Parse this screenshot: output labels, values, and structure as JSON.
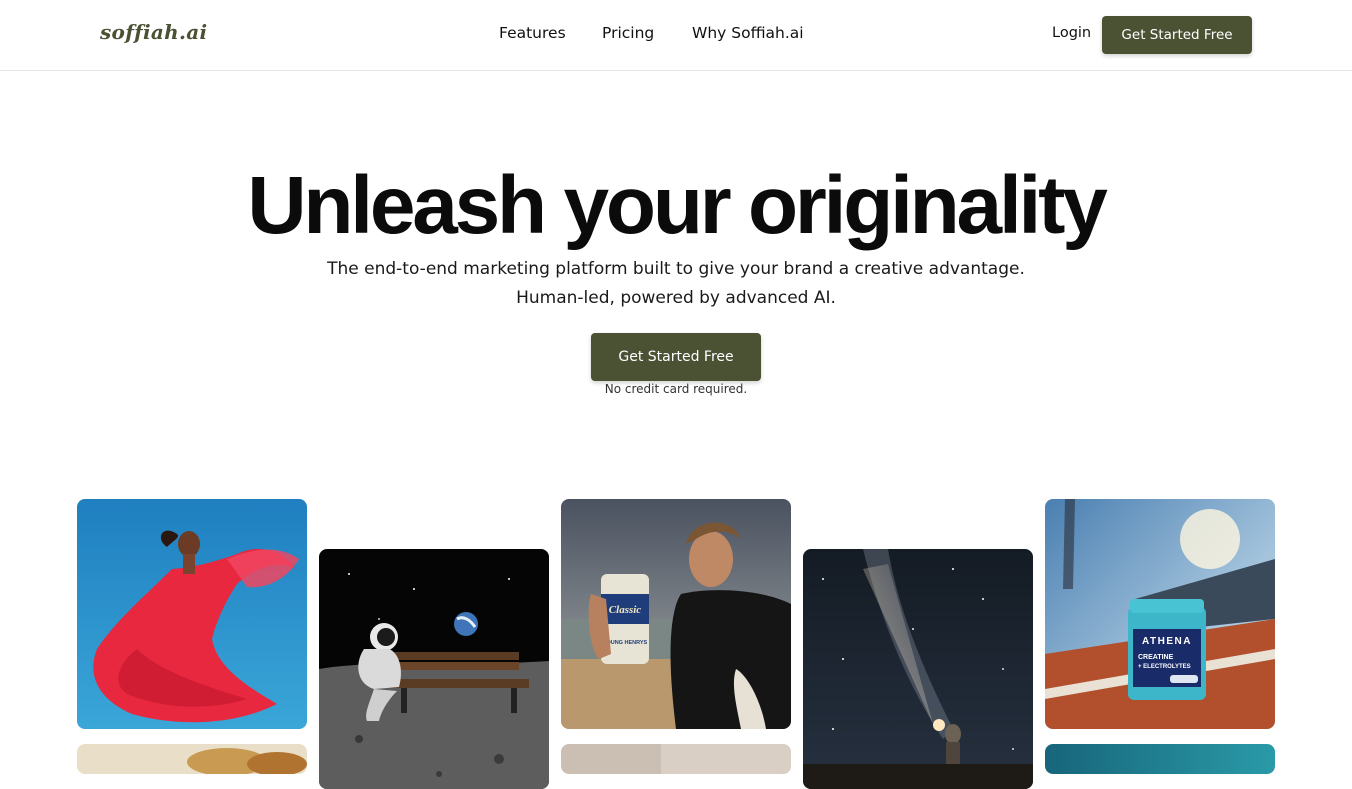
{
  "header": {
    "logo": "soffiah.ai",
    "nav": {
      "features": "Features",
      "pricing": "Pricing",
      "why": "Why Soffiah.ai"
    },
    "login": "Login",
    "cta": "Get Started Free"
  },
  "hero": {
    "title": "Unleash your originality",
    "subtitle_line1": "The end-to-end marketing platform built to give your brand a creative advantage.",
    "subtitle_line2": "Human-led, powered by advanced AI.",
    "cta": "Get Started Free",
    "note": "No credit card required."
  },
  "gallery": {
    "can_label_top": "Classic",
    "can_label_bottom": "YOUNG HENRYS",
    "jar_brand": "ATHENA",
    "jar_line1": "CREATINE",
    "jar_line2": "+ ELECTROLYTES"
  },
  "colors": {
    "brand": "#4b5234",
    "logo": "#4a5233"
  }
}
